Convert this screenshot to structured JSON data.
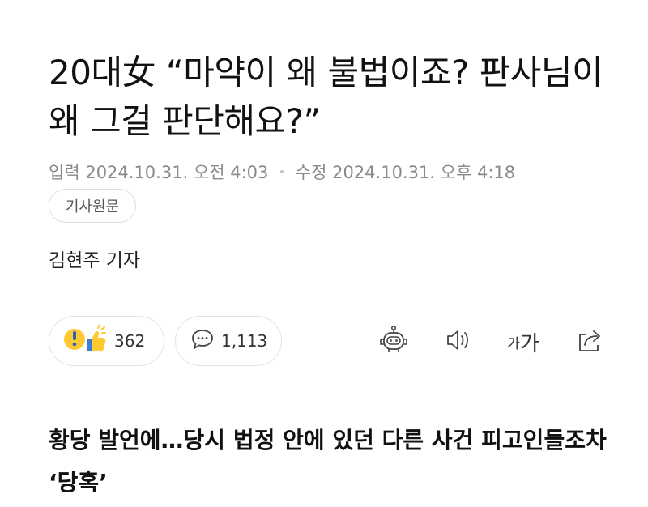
{
  "article": {
    "headline": "20대女 “마약이 왜 불법이죠? 판사님이 왜 그걸 판단해요?”",
    "input_label": "입력",
    "input_time": "2024.10.31. 오전 4:03",
    "edit_label": "수정",
    "edit_time": "2024.10.31. 오후 4:18",
    "original_button": "기사원문",
    "reporter": "김현주 기자",
    "subheadline": "황당 발언에…당시 법정 안에 있던 다른 사건 피고인들조차 ‘당혹’"
  },
  "actions": {
    "reaction_count": "362",
    "comment_count": "1,113",
    "font_small": "가",
    "font_big": "가"
  },
  "icons": {
    "reaction": "surprise-thumbsup-icon",
    "comment": "speech-bubble-icon",
    "robot": "robot-summary-icon",
    "speaker": "speaker-icon",
    "share": "share-icon"
  },
  "colors": {
    "reaction_yellow": "#ffc933",
    "reaction_blue": "#3b7bd9",
    "meta_gray": "#8a8a8a"
  }
}
